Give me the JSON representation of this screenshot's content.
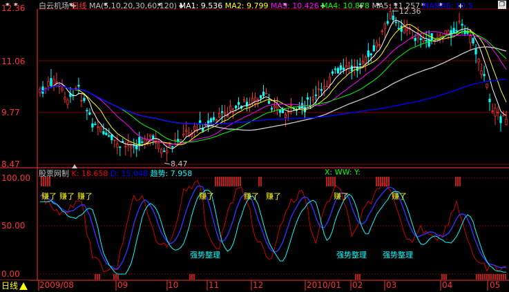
{
  "header": {
    "stock_name": "白云机场",
    "period": "日线",
    "ma_params": "MA(5,10,20,30,60,120)",
    "ma_values": [
      {
        "label": "MA1: 9.536",
        "color": "#ffffff"
      },
      {
        "label": "MA2: 9.799",
        "color": "#ffff00"
      },
      {
        "label": "MA3: 10.426",
        "color": "#ff00ff"
      },
      {
        "label": "MA4: 10.878",
        "color": "#00ff00"
      },
      {
        "label": "MA5: 11.257",
        "color": "#c0c0c0"
      },
      {
        "label": "MAMA6: 10.5",
        "color": "#0000ff"
      }
    ]
  },
  "price_axis": [
    "12.36",
    "11.06",
    "9.77",
    "8.47"
  ],
  "price_annotations": {
    "high": "12.36",
    "low": "8.47"
  },
  "indicator": {
    "name": "股票网制",
    "values": [
      {
        "label": "K: 18.658",
        "color": "#ff0000"
      },
      {
        "label": "D: 15.048",
        "color": "#0000ff"
      },
      {
        "label": "趋势: 7.958",
        "color": "#00ffff"
      }
    ],
    "extra": "X: WW: Y:",
    "axis": [
      "100.00",
      "50.00",
      "0.00"
    ],
    "signals": [
      "赚了",
      "赚了",
      "赚了",
      "赚了",
      "赚了",
      "赚了",
      "赚了",
      "赚了"
    ],
    "annotations": [
      "强势整理",
      "强势整理",
      "强势整理"
    ]
  },
  "time_axis": [
    "2009/08",
    "09",
    "10",
    "11",
    "12",
    "2010/01",
    "02",
    "03",
    "04",
    "05"
  ],
  "bottom_tab": {
    "label": "日线"
  },
  "colors": {
    "up": "#ff3333",
    "down": "#00ffff",
    "grid": "#800000",
    "axis": "#ff3333"
  },
  "chart_data": [
    {
      "type": "candlestick",
      "title": "白云机场",
      "ylim": [
        8.47,
        12.36
      ],
      "ma_lines": [
        "MA1",
        "MA2",
        "MA3",
        "MA4",
        "MA5",
        "MAMA6"
      ]
    },
    {
      "type": "line",
      "ylim": [
        0,
        100
      ],
      "series": [
        {
          "name": "K"
        },
        {
          "name": "D"
        },
        {
          "name": "趋势"
        }
      ]
    }
  ]
}
